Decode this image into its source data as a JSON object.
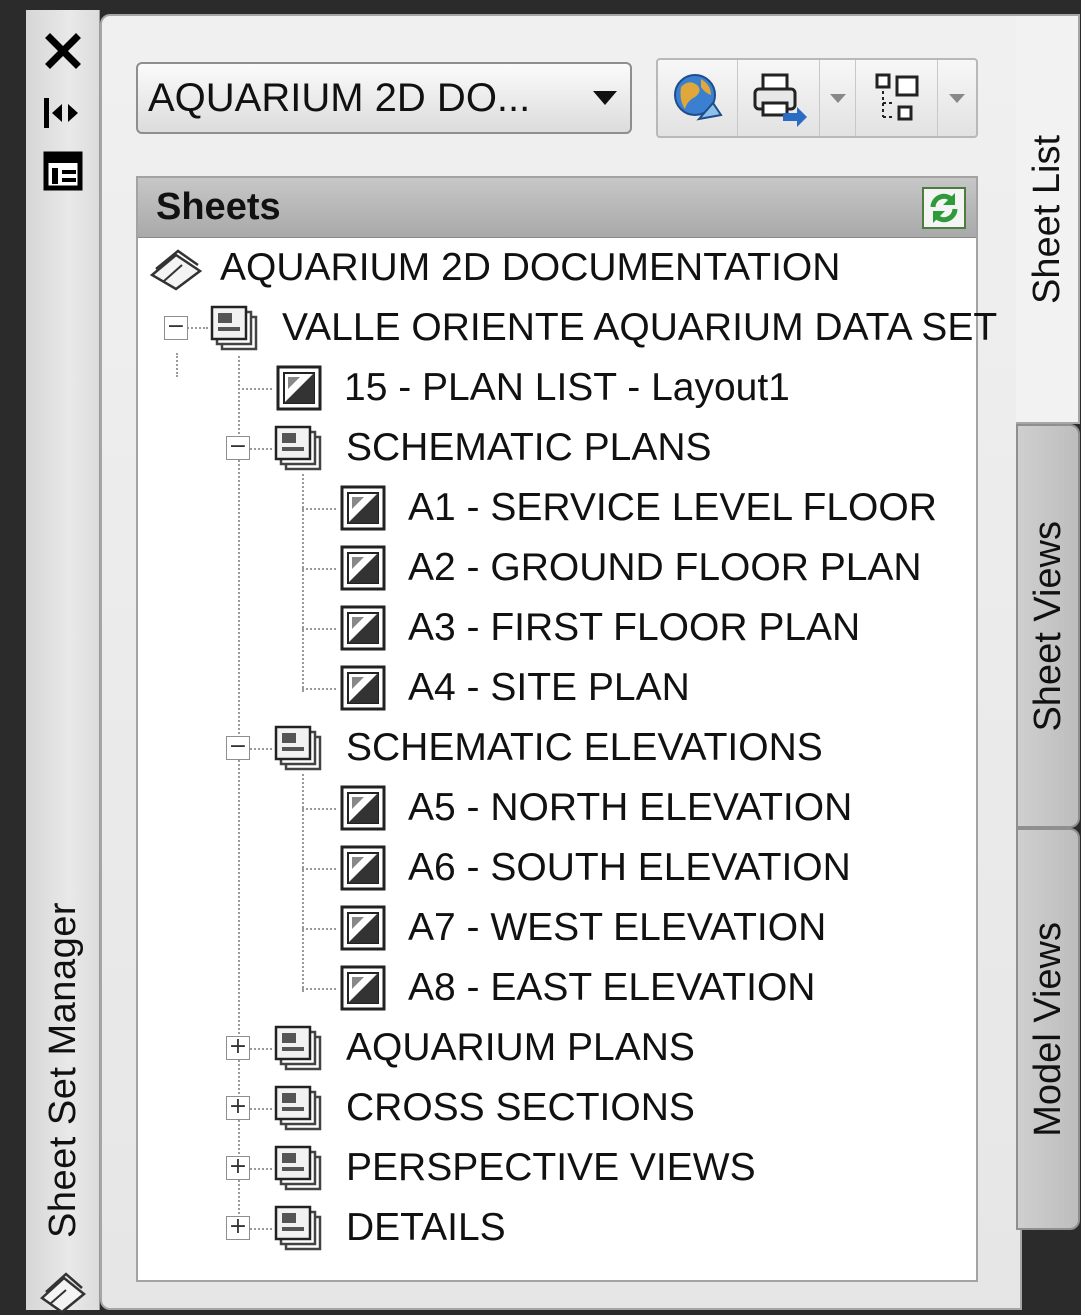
{
  "strip": {
    "title": "Sheet Set Manager"
  },
  "combo": {
    "value": "AQUARIUM 2D DO..."
  },
  "sheets_panel": {
    "title": "Sheets"
  },
  "tree": {
    "root": "AQUARIUM 2D DOCUMENTATION",
    "subset": "VALLE ORIENTE AQUARIUM DATA SET",
    "items": [
      {
        "label": "15 - PLAN LIST - Layout1"
      },
      {
        "label": "SCHEMATIC PLANS"
      },
      {
        "label": "A1 - SERVICE LEVEL FLOOR"
      },
      {
        "label": "A2 - GROUND FLOOR PLAN"
      },
      {
        "label": "A3 - FIRST FLOOR PLAN"
      },
      {
        "label": "A4 - SITE PLAN"
      },
      {
        "label": "SCHEMATIC ELEVATIONS"
      },
      {
        "label": "A5 - NORTH ELEVATION"
      },
      {
        "label": "A6 - SOUTH ELEVATION"
      },
      {
        "label": "A7 - WEST ELEVATION"
      },
      {
        "label": "A8 - EAST ELEVATION"
      },
      {
        "label": "AQUARIUM PLANS"
      },
      {
        "label": "CROSS SECTIONS"
      },
      {
        "label": "PERSPECTIVE VIEWS"
      },
      {
        "label": "DETAILS"
      }
    ],
    "toggles": {
      "collapse": "−",
      "expand": "+"
    }
  },
  "tabs": {
    "sheet_list": "Sheet List",
    "sheet_views": "Sheet Views",
    "model_views": "Model Views"
  },
  "colors": {
    "accent_green": "#2f9a3a",
    "refresh_border": "#4d7d3d"
  }
}
